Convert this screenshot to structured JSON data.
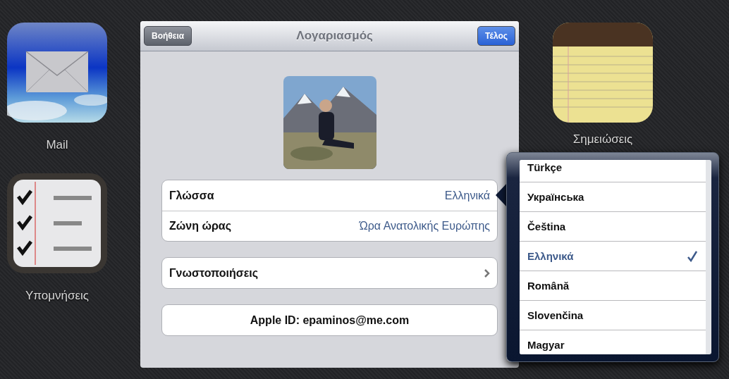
{
  "left_apps": [
    {
      "kind": "mail",
      "label": "Mail"
    },
    {
      "kind": "reminders",
      "label": "Υπομνήσεις"
    }
  ],
  "right_apps": [
    {
      "kind": "notes",
      "label": "Σημειώσεις"
    }
  ],
  "sheet": {
    "title": "Λογαριασμός",
    "left_button": "Βοήθεια",
    "right_button": "Τέλος",
    "groups": [
      {
        "rows": [
          {
            "kind": "value",
            "label": "Γλώσσα",
            "value": "Ελληνικά"
          },
          {
            "kind": "value",
            "label": "Ζώνη ώρας",
            "value": "Ώρα Ανατολικής Ευρώπης"
          }
        ]
      },
      {
        "rows": [
          {
            "kind": "disclosure",
            "label": "Γνωστοποιήσεις"
          }
        ]
      },
      {
        "rows": [
          {
            "kind": "centered",
            "label": "Apple ID: epaminos@me.com"
          }
        ]
      }
    ]
  },
  "language_popover": {
    "items": [
      {
        "label": "Türkçe",
        "selected": false
      },
      {
        "label": "Українська",
        "selected": false
      },
      {
        "label": "Čeština",
        "selected": false
      },
      {
        "label": "Ελληνικά",
        "selected": true
      },
      {
        "label": "Română",
        "selected": false
      },
      {
        "label": "Slovenčina",
        "selected": false
      },
      {
        "label": "Magyar",
        "selected": false
      }
    ]
  }
}
